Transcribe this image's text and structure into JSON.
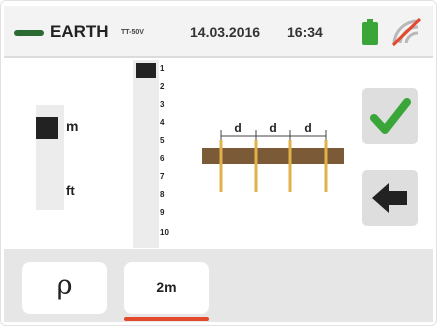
{
  "header": {
    "mode_title": "EARTH",
    "mode_subtitle": "TT-50V",
    "date": "14.03.2016",
    "time": "16:34",
    "battery_icon": "battery-icon",
    "rf_icon": "rf-disabled-icon",
    "accent_color": "#2b6a33"
  },
  "unit_selector": {
    "options": [
      "m",
      "ft"
    ],
    "selected": "m"
  },
  "distance_selector": {
    "values": [
      "1",
      "2",
      "3",
      "4",
      "5",
      "6",
      "7",
      "8",
      "9",
      "10"
    ],
    "selected": "1"
  },
  "diagram": {
    "labels": [
      "d",
      "d",
      "d"
    ],
    "icon": "earth-stakes-diagram"
  },
  "buttons": {
    "confirm_icon": "checkmark-icon",
    "back_icon": "arrow-left-icon",
    "confirm_color": "#3aa63a"
  },
  "tabs": {
    "items": [
      {
        "label": "ρ"
      },
      {
        "label": "2m"
      }
    ],
    "active_index": 1,
    "active_color": "#e2492d"
  }
}
